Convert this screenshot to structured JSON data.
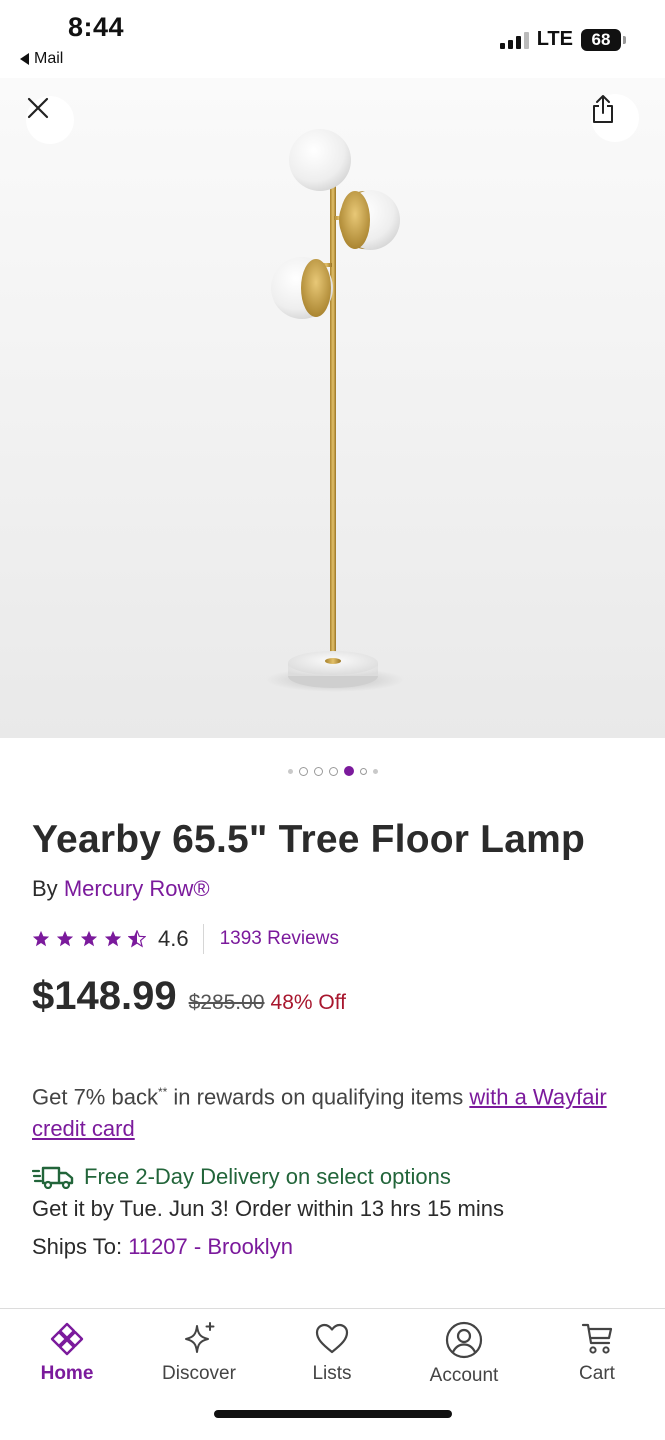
{
  "status_bar": {
    "time": "8:44",
    "back_app": "Mail",
    "network": "LTE",
    "battery": "68"
  },
  "hero": {
    "close_icon": "close-icon",
    "share_icon": "share-icon",
    "image_count": 7,
    "active_image_index": 4
  },
  "product": {
    "title": "Yearby 65.5\" Tree Floor Lamp",
    "by_prefix": "By",
    "brand": "Mercury Row®",
    "rating": "4.6",
    "rating_value": 4.6,
    "reviews": "1393 Reviews",
    "price": "$148.99",
    "original_price": "$285.00",
    "discount": "48% Off"
  },
  "rewards": {
    "text_before": "Get 7% back",
    "marker": "**",
    "text_after": " in rewards on qualifying items ",
    "link": "with a Wayfair credit card"
  },
  "delivery": {
    "headline": "Free 2-Day Delivery on select options",
    "get_it_by": "Get it by Tue. Jun 3! Order within 13 hrs 15 mins",
    "ships_to_label": "Ships To:",
    "ships_to_value": "11207 - Brooklyn"
  },
  "bottom_nav": {
    "items": [
      {
        "label": "Home",
        "icon": "home-icon"
      },
      {
        "label": "Discover",
        "icon": "sparkle-icon"
      },
      {
        "label": "Lists",
        "icon": "heart-icon"
      },
      {
        "label": "Account",
        "icon": "account-icon"
      },
      {
        "label": "Cart",
        "icon": "cart-icon"
      }
    ]
  },
  "colors": {
    "brand_purple": "#7b1a9c",
    "sale_red": "#a8172e",
    "delivery_green": "#22653a",
    "text_dark": "#2b2b2b"
  }
}
